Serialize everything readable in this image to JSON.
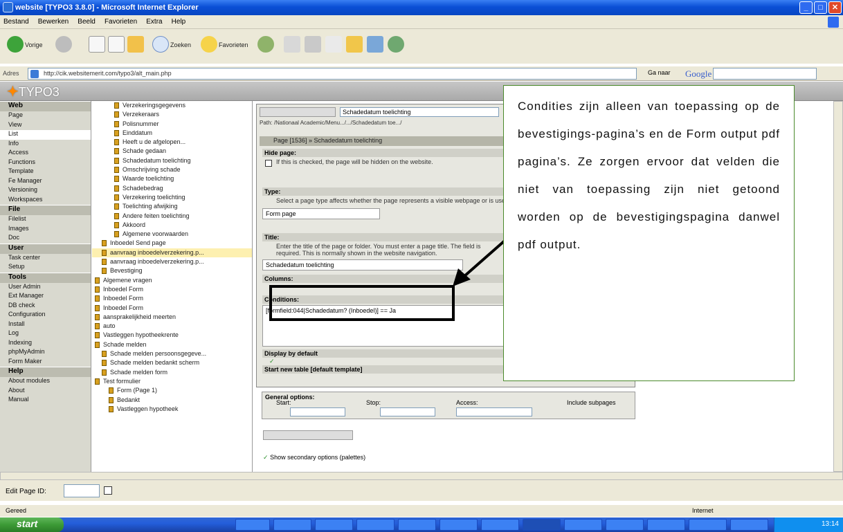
{
  "window": {
    "title": "website [TYPO3 3.8.0] - Microsoft Internet Explorer"
  },
  "menu": [
    "Bestand",
    "Bewerken",
    "Beeld",
    "Favorieten",
    "Extra",
    "Help"
  ],
  "toolbar": {
    "back_label": "Vorige",
    "search_label": "Zoeken",
    "favorites_label": "Favorieten"
  },
  "address": {
    "label": "Adres",
    "url": "http://cik.websitemerit.com/typo3/alt_main.php",
    "go_label": "Ga naar",
    "search_brand": "Google"
  },
  "typo3": {
    "logo": "TYPO3"
  },
  "modules": [
    {
      "type": "head",
      "label": "Web"
    },
    {
      "type": "item",
      "label": "Page"
    },
    {
      "type": "item",
      "label": "View"
    },
    {
      "type": "item",
      "label": "List"
    },
    {
      "type": "item",
      "label": "Info"
    },
    {
      "type": "item",
      "label": "Access"
    },
    {
      "type": "item",
      "label": "Functions"
    },
    {
      "type": "item",
      "label": "Template"
    },
    {
      "type": "item",
      "label": "Fe Manager"
    },
    {
      "type": "item",
      "label": "Versioning"
    },
    {
      "type": "item",
      "label": "Workspaces"
    },
    {
      "type": "head",
      "label": "File"
    },
    {
      "type": "item",
      "label": "Filelist"
    },
    {
      "type": "item",
      "label": "Images"
    },
    {
      "type": "item",
      "label": "Doc"
    },
    {
      "type": "head",
      "label": "User"
    },
    {
      "type": "item",
      "label": "Task center"
    },
    {
      "type": "item",
      "label": "Setup"
    },
    {
      "type": "head",
      "label": "Tools"
    },
    {
      "type": "item",
      "label": "User Admin"
    },
    {
      "type": "item",
      "label": "Ext Manager"
    },
    {
      "type": "item",
      "label": "DB check"
    },
    {
      "type": "item",
      "label": "Configuration"
    },
    {
      "type": "item",
      "label": "Install"
    },
    {
      "type": "item",
      "label": "Log"
    },
    {
      "type": "item",
      "label": "Indexing"
    },
    {
      "type": "item",
      "label": "phpMyAdmin"
    },
    {
      "type": "item",
      "label": "Form Maker"
    },
    {
      "type": "head",
      "label": "Help"
    },
    {
      "type": "item",
      "label": "About modules"
    },
    {
      "type": "item",
      "label": "About"
    },
    {
      "type": "item",
      "label": "Manual"
    }
  ],
  "tree": [
    "Verzekeringsgegevens",
    "Verzekeraars",
    "Polisnummer",
    "Einddatum",
    "Heeft u de afgelopen...",
    "Schade gedaan",
    "Schadedatum toelichting",
    "Omschrijving schade",
    "Waarde toelichting",
    "Schadebedrag",
    "Verzekering toelichting",
    "Toelichting afwijking",
    "Andere feiten toelichting",
    "Akkoord",
    "Algemene voorwaarden",
    "Inboedel Send page",
    "aanvraag inboedelverzekering.p...",
    "aanvraag inboedelverzekering.p...",
    "Bevestiging",
    "Algemene vragen",
    "Inboedel Form",
    "Inboedel Form",
    "Inboedel Form",
    "aansprakelijkheid meerten",
    "auto",
    "Vastleggen hypotheekrente",
    "Schade melden",
    "Schade melden persoonsgegeve...",
    "Schade melden bedankt scherm",
    "Schade melden form",
    "Test formulier",
    "Form (Page 1)",
    "Bedankt",
    "Vastleggen hypotheek"
  ],
  "doc": {
    "record_select": "Schadedatum toelichting",
    "path": "Path: /Nationaal Academic/Menu.../.../Schadedatum toe.../",
    "page_header": "Page [1536] » Schadedatum toelichting",
    "hide_label": "Hide page:",
    "hide_desc": "If this is checked, the page will be hidden on the website.",
    "type_label": "Type:",
    "type_desc": "Select a page type affects whether the page represents a visible webpage or is used for other purposes.",
    "type_value": "Form page",
    "title_label": "Title:",
    "title_desc": "Enter the title of the page or folder. You must enter a page title. The field is required. This is normally shown in the website navigation.",
    "title_value": "Schadedatum toelichting",
    "columns_label": "Columns:",
    "conditions_label": "Conditions:",
    "conditions_value": "[formfield:044|Schadedatum? (Inboedel)] == Ja",
    "display_label": "Display by default",
    "newtable_label": "Start new table [default template]",
    "general_label": "General options:",
    "start_label": "Start:",
    "stop_label": "Stop:",
    "access_label": "Access:",
    "include_label": "Include subpages",
    "secondary_label": "Show secondary options (palettes)"
  },
  "callout": "Condities zijn alleen van toepassing op de bevestigings-pagina’s en de Form output pdf pagina’s. Ze zorgen ervoor dat velden die niet van toepassing zijn niet getoond worden op de bevestigingspagina danwel pdf output.",
  "editbar": {
    "label": "Edit Page ID:"
  },
  "status": {
    "left": "Gereed",
    "zone": "Internet"
  },
  "taskbar": {
    "start": "start",
    "clock": "13:14"
  }
}
